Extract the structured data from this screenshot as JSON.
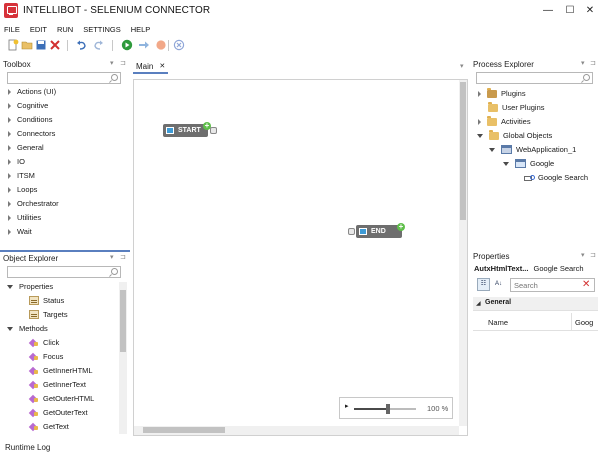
{
  "window": {
    "title": "INTELLIBOT - SELENIUM CONNECTOR",
    "minimize": "—",
    "maximize": "☐",
    "close": "✕"
  },
  "menu": [
    "FILE",
    "EDIT",
    "RUN",
    "SETTINGS",
    "HELP"
  ],
  "toolbar": {
    "icons": [
      "new-icon",
      "open-icon",
      "save-icon",
      "delete-icon",
      "undo-icon",
      "redo-icon",
      "run-icon",
      "step-icon",
      "record-icon",
      "stop-icon"
    ]
  },
  "toolbox": {
    "header": "Toolbox",
    "search_placeholder": "",
    "items": [
      "Actions (UI)",
      "Cognitive",
      "Conditions",
      "Connectors",
      "General",
      "IO",
      "ITSM",
      "Loops",
      "Orchestrator",
      "Utilities",
      "Wait"
    ]
  },
  "object_explorer": {
    "header": "Object Explorer",
    "properties_label": "Properties",
    "properties": [
      "Status",
      "Targets"
    ],
    "methods_label": "Methods",
    "methods": [
      "Click",
      "Focus",
      "GetInnerHTML",
      "GetInnerText",
      "GetOuterHTML",
      "GetOuterText",
      "GetText"
    ]
  },
  "runtime_log": "Runtime Log",
  "designer": {
    "tab_label": "Main",
    "tab_close": "✕",
    "start_label": "START",
    "end_label": "END",
    "zoom_level": "100 %",
    "zoom_value": 0.55
  },
  "process_explorer": {
    "header": "Process Explorer",
    "items": {
      "plugins": "Plugins",
      "user_plugins": "User Plugins",
      "activities": "Activities",
      "global_objects": "Global Objects",
      "web_app": "WebApplication_1",
      "google": "Google",
      "google_search": "Google Search"
    }
  },
  "properties": {
    "header": "Properties",
    "object_type": "AutxHtmlText...",
    "object_name": "Google Search",
    "search_placeholder": "Search",
    "clear": "✕",
    "category": "General",
    "row_name": "Name",
    "row_value": "Goog"
  },
  "colors": {
    "accent": "#d6323a",
    "node": "#6e6e6e",
    "plus": "#5fbf4a",
    "tab_underline": "#5a7fbf"
  }
}
